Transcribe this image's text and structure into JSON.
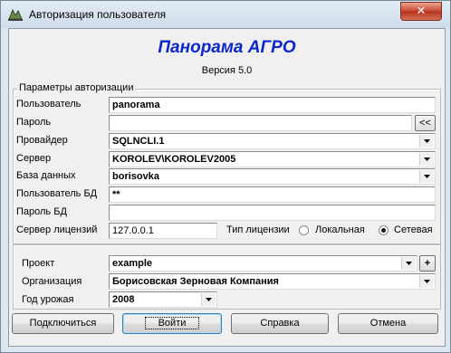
{
  "window": {
    "title": "Авторизация пользователя",
    "close_label": "✕",
    "accent_color": "#0b27c9",
    "close_color": "#c7452e"
  },
  "header": {
    "app_name": "Панорама АГРО",
    "version": "Версия 5.0"
  },
  "auth": {
    "legend": "Параметры авторизации",
    "user_label": "Пользователь",
    "user_value": "panorama",
    "password_label": "Пароль",
    "password_value": "",
    "password_button": "<<",
    "provider_label": "Провайдер",
    "provider_value": "SQLNCLI.1",
    "server_label": "Сервер",
    "server_value": "KOROLEV\\KOROLEV2005",
    "database_label": "База данных",
    "database_value": "borisovka",
    "db_user_label": "Пользователь БД",
    "db_user_value": "**",
    "db_password_label": "Пароль БД",
    "db_password_value": "",
    "license_server_label": "Сервер лицензий",
    "license_server_value": "127.0.0.1",
    "license_type_label": "Тип лицензии",
    "license_local": "Локальная",
    "license_network": "Сетевая",
    "license_selected": "Сетевая"
  },
  "project": {
    "project_label": "Проект",
    "project_value": "example",
    "project_add": "+",
    "org_label": "Организация",
    "org_value": "Борисовская Зерновая Компания",
    "year_label": "Год урожая",
    "year_value": "2008"
  },
  "buttons": {
    "connect": "Подключиться",
    "login": "Войти",
    "help": "Справка",
    "cancel": "Отмена"
  }
}
